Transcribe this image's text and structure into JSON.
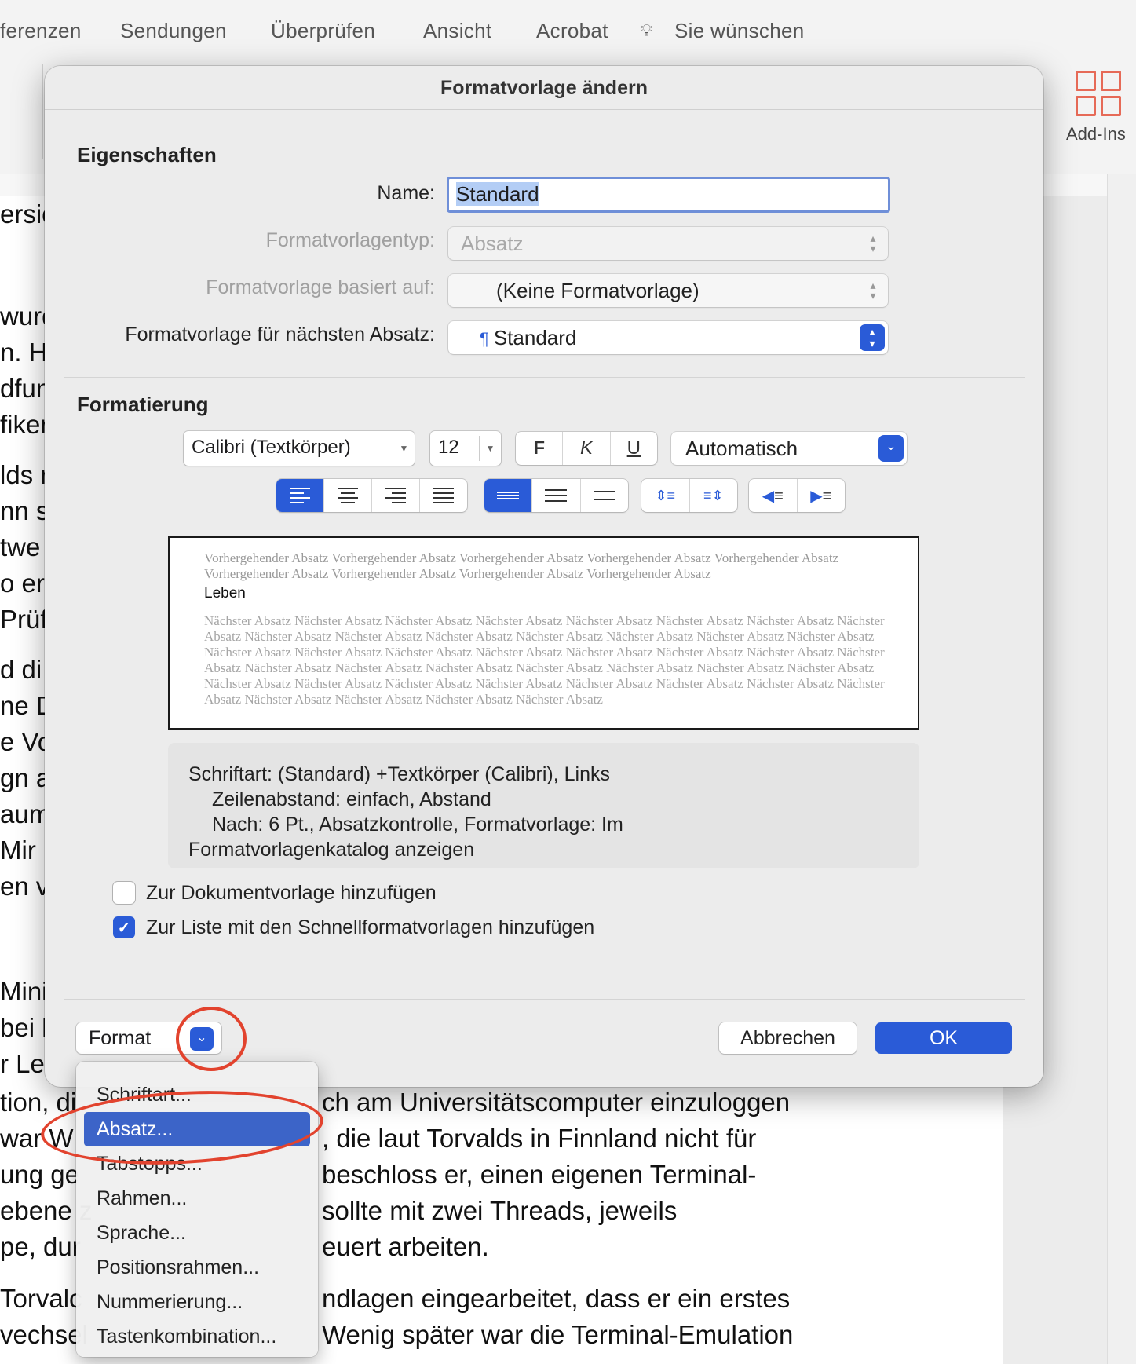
{
  "ribbon": {
    "tabs": [
      "ferenzen",
      "Sendungen",
      "Überprüfen",
      "Ansicht",
      "Acrobat",
      "Sie wünschen"
    ],
    "addins_label": "Add-Ins"
  },
  "document": {
    "left_fragments": [
      "ersio",
      "wurd",
      "n. H",
      "dfun",
      "fiker",
      "lds r",
      "nn se",
      "twe",
      "o er",
      "Prüf",
      "d di",
      "ne D",
      "e Vo",
      "gn ar",
      "aum",
      " Mir",
      "en v",
      "Mini",
      "bei le",
      "r Le",
      "tion, di",
      "war W",
      "ung ge",
      "ebene z",
      "pe, dur",
      "Torvalc",
      "vechsel"
    ],
    "right_fragments": [
      "ch am Universitätscomputer einzuloggen",
      ", die laut Torvalds in Finnland nicht für",
      "beschloss er, einen eigenen Terminal-",
      "sollte mit zwei Threads, jeweils",
      "euert arbeiten.",
      "ndlagen eingearbeitet, dass er ein erstes",
      "Wenig später war die Terminal-Emulation"
    ]
  },
  "dialog": {
    "title": "Formatvorlage ändern",
    "properties_heading": "Eigenschaften",
    "name_label": "Name:",
    "name_value": "Standard",
    "type_label": "Formatvorlagentyp:",
    "type_value": "Absatz",
    "based_on_label": "Formatvorlage basiert auf:",
    "based_on_value": "(Keine Formatvorlage)",
    "next_label": "Formatvorlage für nächsten Absatz:",
    "next_value": "Standard",
    "formatting_heading": "Formatierung",
    "font_name": "Calibri (Textkörper)",
    "font_size": "12",
    "bold": "F",
    "italic": "K",
    "underline": "U",
    "color_value": "Automatisch",
    "preview": {
      "previous": "Vorhergehender Absatz Vorhergehender Absatz Vorhergehender Absatz Vorhergehender Absatz Vorhergehender Absatz Vorhergehender Absatz Vorhergehender Absatz Vorhergehender Absatz Vorhergehender Absatz",
      "current": "Leben",
      "next": "Nächster Absatz Nächster Absatz Nächster Absatz Nächster Absatz Nächster Absatz Nächster Absatz Nächster Absatz Nächster Absatz Nächster Absatz Nächster Absatz Nächster Absatz Nächster Absatz Nächster Absatz Nächster Absatz Nächster Absatz Nächster Absatz Nächster Absatz Nächster Absatz Nächster Absatz Nächster Absatz Nächster Absatz Nächster Absatz Nächster Absatz Nächster Absatz Nächster Absatz Nächster Absatz Nächster Absatz Nächster Absatz Nächster Absatz Nächster Absatz Nächster Absatz Nächster Absatz Nächster Absatz Nächster Absatz Nächster Absatz Nächster Absatz Nächster Absatz Nächster Absatz Nächster Absatz Nächster Absatz Nächster Absatz Nächster Absatz"
    },
    "description": {
      "line1": "Schriftart: (Standard) +Textkörper (Calibri), Links",
      "line2": "Zeilenabstand:  einfach, Abstand",
      "line3": "Nach:  6 Pt., Absatzkontrolle, Formatvorlage: Im",
      "line4": "Formatvorlagenkatalog anzeigen"
    },
    "check_template": {
      "label": "Zur Dokumentvorlage hinzufügen",
      "checked": false
    },
    "check_quick": {
      "label": "Zur Liste mit den Schnellformatvorlagen hinzufügen",
      "checked": true
    },
    "format_button": "Format",
    "cancel_button": "Abbrechen",
    "ok_button": "OK"
  },
  "format_menu": {
    "items": [
      "Schriftart...",
      "Absatz...",
      "Tabstopps...",
      "Rahmen...",
      "Sprache...",
      "Positionsrahmen...",
      "Nummerierung...",
      "Tastenkombination..."
    ],
    "selected": "Absatz..."
  },
  "colors": {
    "accent": "#2a5bd7",
    "annotation": "#e2432e",
    "addins": "#e66a57"
  }
}
